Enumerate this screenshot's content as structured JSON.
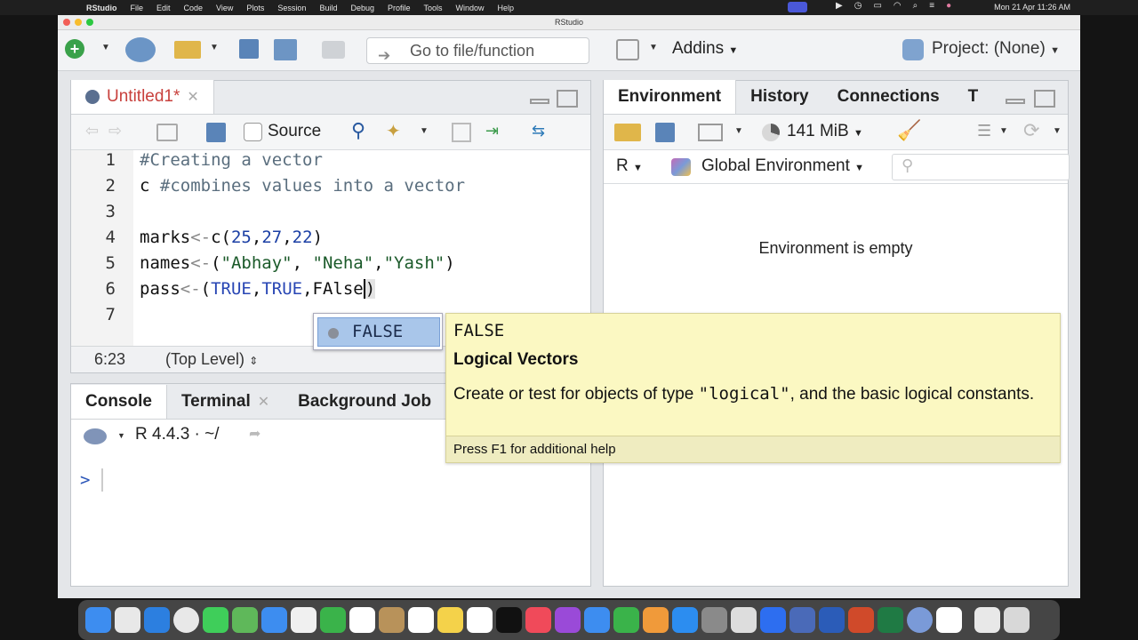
{
  "menubar": {
    "app": "RStudio",
    "items": [
      "File",
      "Edit",
      "Code",
      "View",
      "Plots",
      "Session",
      "Build",
      "Debug",
      "Profile",
      "Tools",
      "Window",
      "Help"
    ],
    "clock": "Mon 21 Apr  11:26 AM"
  },
  "window": {
    "title": "RStudio"
  },
  "main_toolbar": {
    "goto_placeholder": "Go to file/function",
    "addins": "Addins",
    "project": "Project: (None)"
  },
  "editor": {
    "tab": "Untitled1*",
    "source_label": "Source",
    "lines": [
      {
        "n": "1",
        "text": "#Creating a vector"
      },
      {
        "n": "2",
        "text": "c #combines values into a vector"
      },
      {
        "n": "3",
        "text": ""
      },
      {
        "n": "4",
        "text": "marks<-c(25,27,22)"
      },
      {
        "n": "5",
        "text": "names<-(\"Abhay\", \"Neha\",\"Yash\")"
      },
      {
        "n": "6",
        "text": "pass<-(TRUE,TRUE,FAlse)"
      },
      {
        "n": "7",
        "text": ""
      }
    ],
    "status_pos": "6:23",
    "status_scope": "(Top Level)"
  },
  "autocomplete": {
    "item": "FALSE",
    "help_title": "FALSE",
    "help_heading": "Logical Vectors",
    "help_body_pre": "Create or test for objects of type ",
    "help_body_code": "\"logical\"",
    "help_body_post": ", and the basic logical constants.",
    "help_footer": "Press F1 for additional help"
  },
  "console": {
    "tabs": [
      "Console",
      "Terminal",
      "Background Job"
    ],
    "version": "R 4.4.3 · ~/",
    "prompt": ">"
  },
  "environment": {
    "tabs": [
      "Environment",
      "History",
      "Connections",
      "T"
    ],
    "memory": "141 MiB",
    "lang": "R",
    "scope": "Global Environment",
    "empty_msg": "Environment is empty"
  }
}
